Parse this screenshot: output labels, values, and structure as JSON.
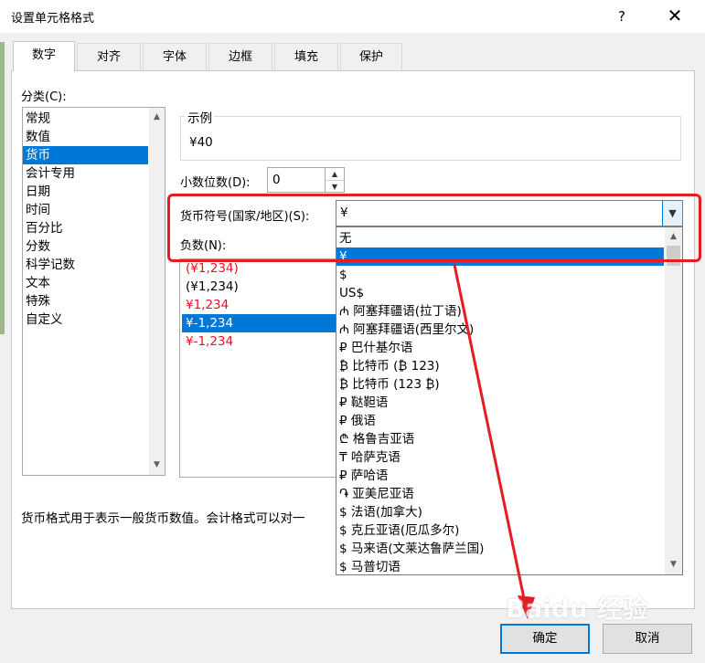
{
  "window": {
    "title": "设置单元格格式",
    "help_label": "?",
    "close_label": "✕"
  },
  "tabs": [
    {
      "label": "数字",
      "active": true
    },
    {
      "label": "对齐"
    },
    {
      "label": "字体"
    },
    {
      "label": "边框"
    },
    {
      "label": "填充"
    },
    {
      "label": "保护"
    }
  ],
  "category": {
    "label": "分类(C):",
    "items": [
      "常规",
      "数值",
      "货币",
      "会计专用",
      "日期",
      "时间",
      "百分比",
      "分数",
      "科学记数",
      "文本",
      "特殊",
      "自定义"
    ],
    "selected": "货币"
  },
  "sample": {
    "legend": "示例",
    "value": "¥40"
  },
  "decimal": {
    "label": "小数位数(D):",
    "value": "0"
  },
  "currency_symbol": {
    "label": "货币符号(国家/地区)(S):",
    "value": "¥",
    "options": [
      "无",
      "¥",
      "$",
      "US$",
      "₼ 阿塞拜疆语(拉丁语)",
      "₼ 阿塞拜疆语(西里尔文)",
      "₽ 巴什基尔语",
      "₿ 比特币 (₿ 123)",
      "₿ 比特币 (123 ₿)",
      "₽ 鞑靼语",
      "₽ 俄语",
      "₾ 格鲁吉亚语",
      "₸ 哈萨克语",
      "₽ 萨哈语",
      "֏ 亚美尼亚语",
      "$ 法语(加拿大)",
      "$ 克丘亚语(厄瓜多尔)",
      "$ 马来语(文莱达鲁萨兰国)",
      "$ 马普切语"
    ],
    "highlighted": "¥"
  },
  "negative": {
    "label": "负数(N):",
    "items": [
      {
        "text": "(¥1,234)",
        "color": "#e81123"
      },
      {
        "text": "(¥1,234)",
        "color": "#000000"
      },
      {
        "text": "¥1,234",
        "color": "#e81123"
      },
      {
        "text": "¥-1,234",
        "color": "#000000",
        "selected": true
      },
      {
        "text": "¥-1,234",
        "color": "#e81123"
      }
    ]
  },
  "description": "货币格式用于表示一般货币数值。会计格式可以对一",
  "buttons": {
    "ok": "确定",
    "cancel": "取消"
  },
  "watermark": "Baidu 经验",
  "colors": {
    "accent": "#0078d7",
    "annotation": "#e51c23",
    "negative_red": "#e81123"
  }
}
